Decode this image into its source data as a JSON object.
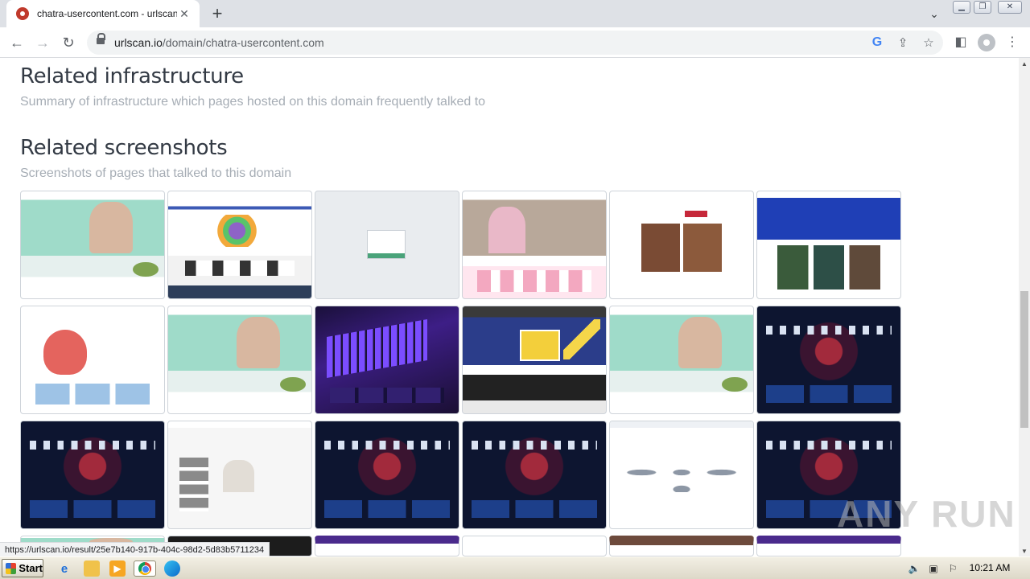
{
  "browser": {
    "tab_title": "chatra-usercontent.com - urlscan.io",
    "new_tab_symbol": "+",
    "tab_close_symbol": "✕",
    "url_host": "urlscan.io",
    "url_path": "/domain/chatra-usercontent.com",
    "google_icon_letter": "G",
    "status_url": "https://urlscan.io/result/25e7b140-917b-404c-98d2-5d83b5711234"
  },
  "icons": {
    "tab_favicon": "urlscan-favicon-icon",
    "back": "arrow-left-icon",
    "forward": "arrow-right-icon",
    "reload": "reload-icon",
    "lock": "lock-icon",
    "google": "google-icon",
    "share": "share-icon",
    "bookmark": "star-icon",
    "side_panel": "side-panel-icon",
    "profile": "profile-icon",
    "menu": "kebab-menu-icon",
    "tab_search": "chevron-down-icon"
  },
  "sections": {
    "infrastructure": {
      "heading": "Related infrastructure",
      "description": "Summary of infrastructure which pages hosted on this domain frequently talked to"
    },
    "screenshots": {
      "heading": "Related screenshots",
      "description": "Screenshots of pages that talked to this domain"
    }
  },
  "screenshots": [
    {
      "variant": "mint"
    },
    {
      "variant": "shop"
    },
    {
      "variant": "login"
    },
    {
      "variant": "photo"
    },
    {
      "variant": "store"
    },
    {
      "variant": "blue"
    },
    {
      "variant": "mask"
    },
    {
      "variant": "mint"
    },
    {
      "variant": "keyboard"
    },
    {
      "variant": "battery"
    },
    {
      "variant": "mint"
    },
    {
      "variant": "casino"
    },
    {
      "variant": "casino"
    },
    {
      "variant": "fashion"
    },
    {
      "variant": "casino"
    },
    {
      "variant": "casino"
    },
    {
      "variant": "plain"
    },
    {
      "variant": "casino"
    },
    {
      "variant": "mint"
    },
    {
      "variant": "dark"
    },
    {
      "variant": "purple"
    },
    {
      "variant": "site"
    },
    {
      "variant": "brown"
    },
    {
      "variant": "purple"
    }
  ],
  "watermark": "ANY RUN",
  "taskbar": {
    "start_label": "Start",
    "clock": "10:21 AM",
    "quicklaunch": [
      "ie-icon",
      "folder-icon",
      "media-player-icon",
      "chrome-icon",
      "edge-icon"
    ],
    "tray": [
      "volume-icon",
      "network-icon",
      "flag-icon"
    ]
  },
  "colors": {
    "heading": "#333a44",
    "subtext": "#a6adb5",
    "tab_strip": "#dee1e6",
    "omnibox": "#f1f3f4"
  }
}
